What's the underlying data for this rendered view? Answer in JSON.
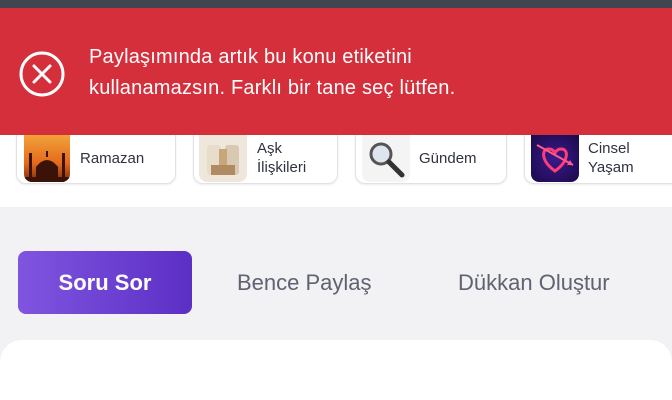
{
  "toast": {
    "message_line1": "Paylaşımında artık bu konu etiketini",
    "message_line2": "kullanamazsın. Farklı bir tane seç lütfen.",
    "icon": "close-circle-icon",
    "background_color": "#d52f3c"
  },
  "topics": [
    {
      "label": "Ramazan",
      "icon": "mosque-icon"
    },
    {
      "label_line1": "Aşk",
      "label_line2": "İlişkileri",
      "icon": "couple-icon"
    },
    {
      "label": "Gündem",
      "icon": "magnifier-icon"
    },
    {
      "label_line1": "Cinsel",
      "label_line2": "Yaşam",
      "icon": "heart-arrow-icon"
    }
  ],
  "tabs": {
    "primary": "Soru Sor",
    "second": "Bence Paylaş",
    "third": "Dükkan Oluştur",
    "accent_color": "#6c3fd4"
  }
}
